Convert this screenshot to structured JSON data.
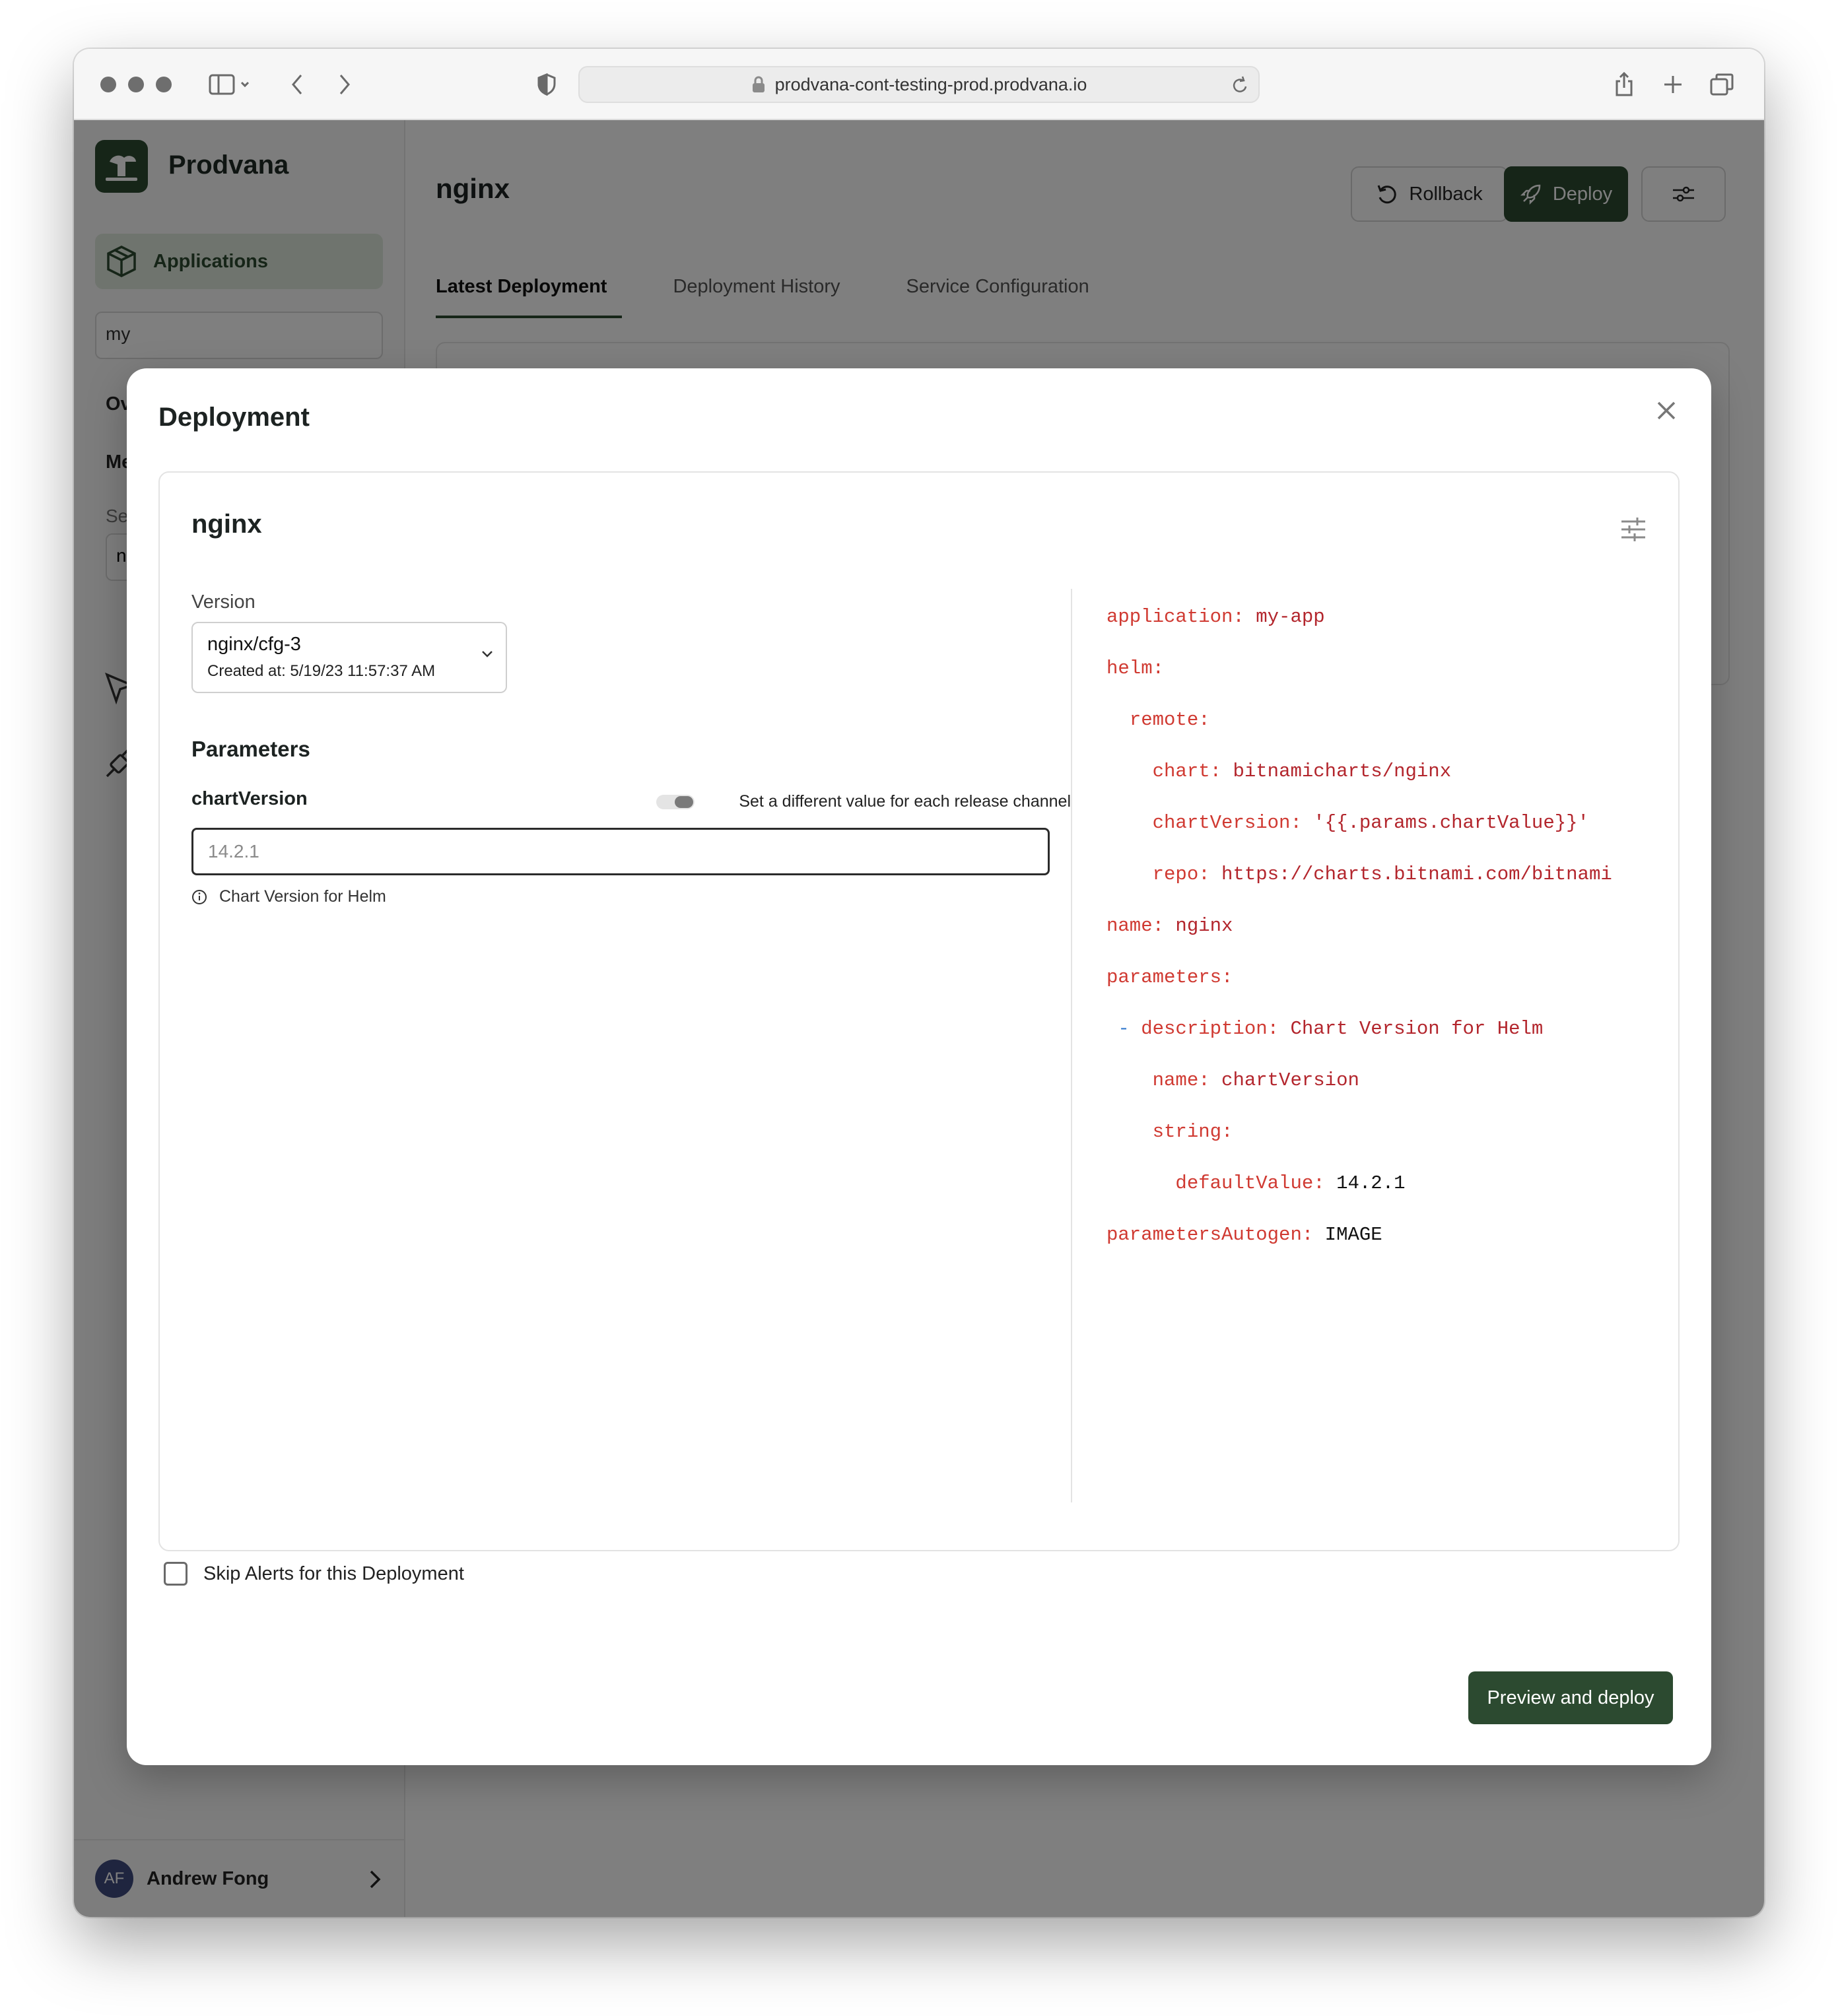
{
  "browser": {
    "url": "prodvana-cont-testing-prod.prodvana.io"
  },
  "sidebar": {
    "brand": "Prodvana",
    "nav_applications": "Applications",
    "app_select_value": "my",
    "item_overview": "Ov",
    "item_me": "Me",
    "section_label": "Se",
    "service_select_value": "n",
    "user": {
      "initials": "AF",
      "name": "Andrew Fong"
    }
  },
  "header": {
    "title": "nginx",
    "rollback_label": "Rollback",
    "deploy_label": "Deploy"
  },
  "tabs": [
    {
      "label": "Latest Deployment",
      "active": true
    },
    {
      "label": "Deployment History",
      "active": false
    },
    {
      "label": "Service Configuration",
      "active": false
    }
  ],
  "modal": {
    "title": "Deployment",
    "service_name": "nginx",
    "version": {
      "label": "Version",
      "selected": "nginx/cfg-3",
      "created_at": "Created at: 5/19/23 11:57:37 AM"
    },
    "parameters": {
      "heading": "Parameters",
      "name": "chartVersion",
      "toggle_label": "Set a different value for each release channel",
      "toggle_on": false,
      "placeholder": "14.2.1",
      "hint": "Chart Version for Helm"
    },
    "config_yaml": [
      {
        "indent": 0,
        "key": "application:",
        "value": "my-app"
      },
      {
        "indent": 0,
        "key": "helm:",
        "value": ""
      },
      {
        "indent": 1,
        "key": "remote:",
        "value": ""
      },
      {
        "indent": 2,
        "key": "chart:",
        "value": "bitnamicharts/nginx"
      },
      {
        "indent": 2,
        "key": "chartVersion:",
        "value": "'{{.params.chartValue}}'"
      },
      {
        "indent": 2,
        "key": "repo:",
        "value": "https://charts.bitnami.com/bitnami"
      },
      {
        "indent": 0,
        "key": "name:",
        "value": "nginx"
      },
      {
        "indent": 0,
        "key": "parameters:",
        "value": ""
      },
      {
        "indent": 1,
        "dash": "-",
        "key": "description:",
        "value": "Chart Version for Helm"
      },
      {
        "indent": 2,
        "key": "name:",
        "value": "chartVersion"
      },
      {
        "indent": 2,
        "key": "string:",
        "value": ""
      },
      {
        "indent": 3,
        "key": "defaultValue:",
        "value": "14.2.1",
        "numeric": true
      },
      {
        "indent": 0,
        "key": "parametersAutogen:",
        "value": "IMAGE",
        "numeric": true
      }
    ],
    "skip_alerts_label": "Skip Alerts for this Deployment",
    "skip_alerts_checked": false,
    "submit_label": "Preview and deploy"
  },
  "colors": {
    "brand_green": "#2c4a30",
    "yaml_key": "#d03a32",
    "yaml_value": "#b3262d"
  }
}
